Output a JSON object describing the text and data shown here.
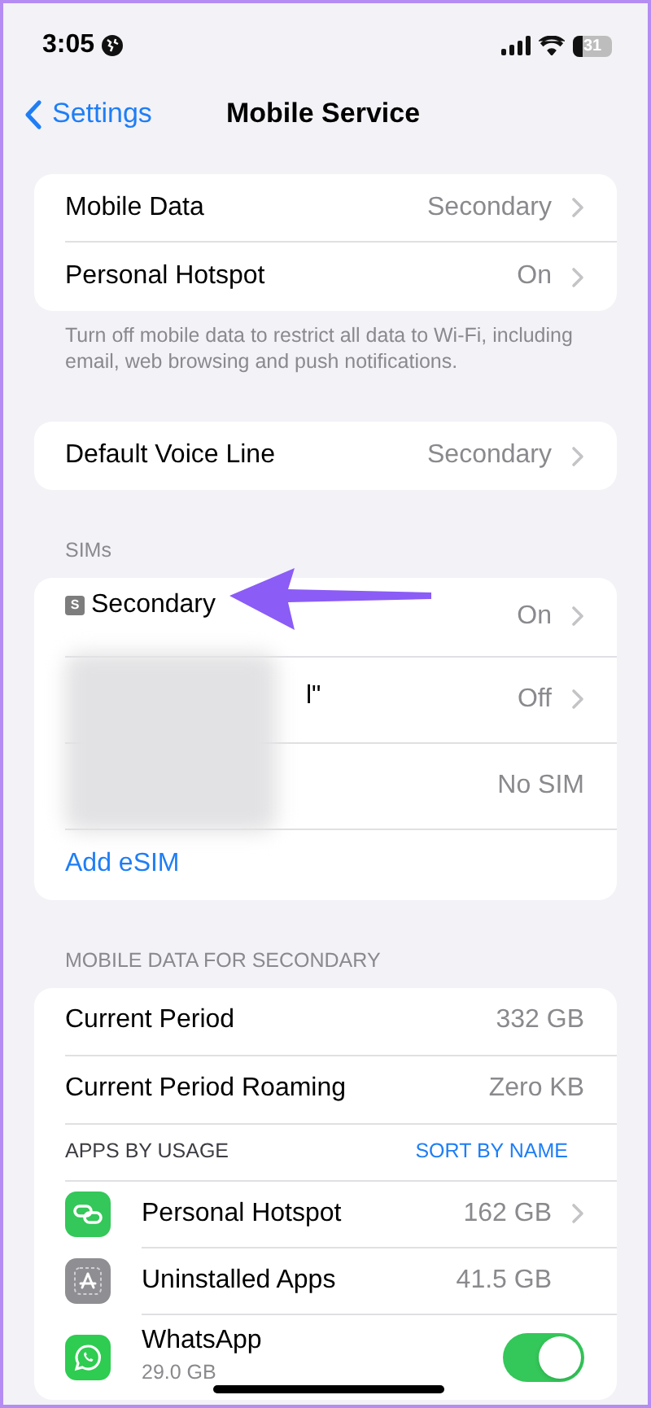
{
  "status_bar": {
    "time": "3:05",
    "battery": "31"
  },
  "nav": {
    "back": "Settings",
    "title": "Mobile Service"
  },
  "sections": [
    {
      "rows": [
        {
          "kind": "value",
          "label": "Mobile Data",
          "value": "Secondary",
          "chevron": true
        },
        {
          "kind": "value",
          "label": "Personal Hotspot",
          "value": "On",
          "chevron": true
        }
      ],
      "footer": "Turn off mobile data to restrict all data to Wi-Fi, including email, web browsing and push notifications."
    },
    {
      "rows": [
        {
          "kind": "value",
          "label": "Default Voice Line",
          "value": "Secondary",
          "chevron": true
        }
      ]
    },
    {
      "header": "SIMs",
      "rows": [
        {
          "kind": "sim",
          "badge": "S",
          "label": "Secondary",
          "value": "On",
          "chevron": true
        },
        {
          "kind": "redacted",
          "label": "l\"",
          "value": "Off",
          "chevron": true
        },
        {
          "kind": "redacted",
          "value": "No SIM",
          "chevron": false
        },
        {
          "kind": "link",
          "label": "Add eSIM"
        }
      ]
    },
    {
      "header": "MOBILE DATA FOR SECONDARY",
      "rows": [
        {
          "kind": "value",
          "label": "Current Period",
          "value": "332 GB",
          "chevron": false
        },
        {
          "kind": "value",
          "label": "Current Period Roaming",
          "value": "Zero KB",
          "chevron": false
        },
        {
          "kind": "subheader",
          "label": "APPS BY USAGE",
          "action": "SORT BY NAME"
        },
        {
          "kind": "app",
          "label": "Personal Hotspot",
          "value": "162 GB",
          "chevron": true
        },
        {
          "kind": "app",
          "label": "Uninstalled Apps",
          "value": "41.5 GB",
          "chevron": false
        },
        {
          "kind": "toggle",
          "label": "WhatsApp",
          "subtitle": "29.0 GB",
          "on": true
        }
      ]
    }
  ]
}
